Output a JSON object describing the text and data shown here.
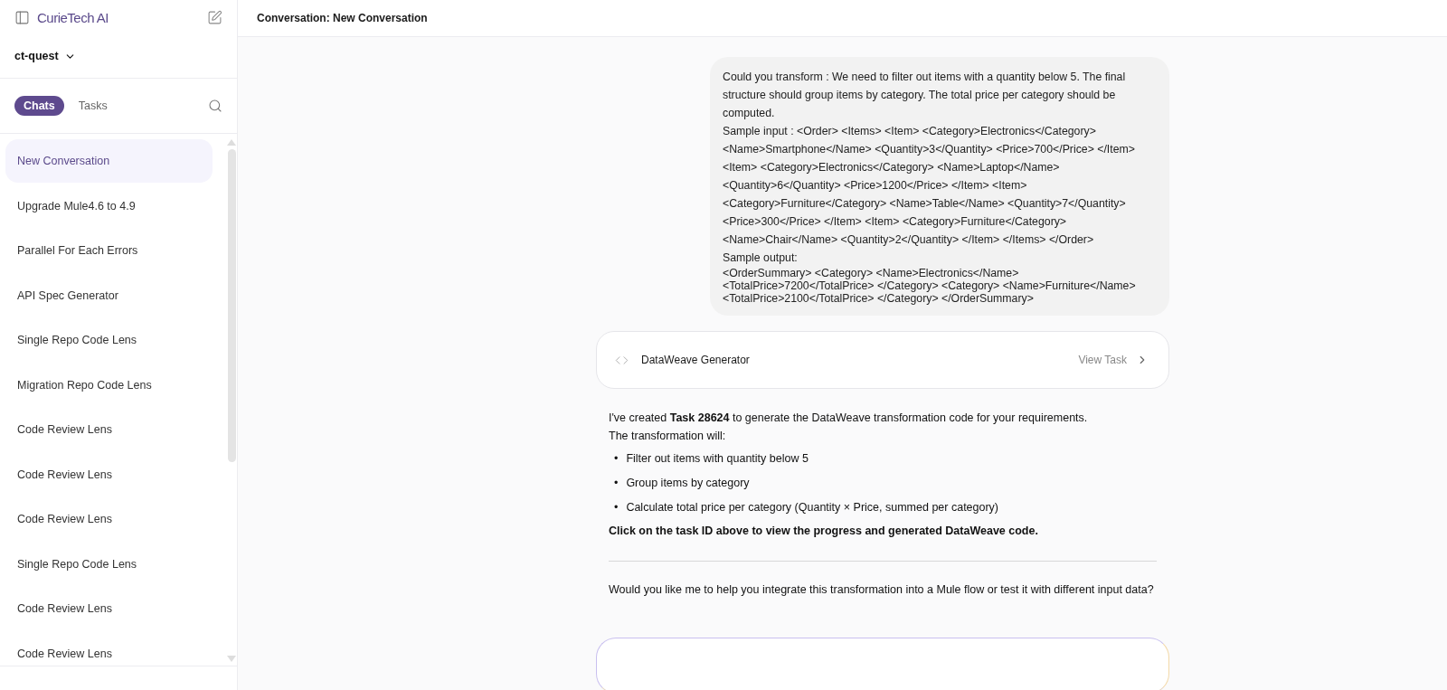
{
  "sidebar": {
    "brand": "CurieTech AI",
    "workspace": "ct-quest",
    "tabs": [
      {
        "label": "Chats",
        "selected": true
      },
      {
        "label": "Tasks",
        "selected": false
      }
    ],
    "items": [
      {
        "label": "New Conversation",
        "selected": true
      },
      {
        "label": "Upgrade Mule4.6 to 4.9",
        "selected": false
      },
      {
        "label": "Parallel For Each Errors",
        "selected": false
      },
      {
        "label": "API Spec Generator",
        "selected": false
      },
      {
        "label": "Single Repo Code Lens",
        "selected": false
      },
      {
        "label": "Migration Repo Code Lens",
        "selected": false
      },
      {
        "label": "Code Review Lens",
        "selected": false
      },
      {
        "label": "Code Review Lens",
        "selected": false
      },
      {
        "label": "Code Review Lens",
        "selected": false
      },
      {
        "label": "Single Repo Code Lens",
        "selected": false
      },
      {
        "label": "Code Review Lens",
        "selected": false
      },
      {
        "label": "Code Review Lens",
        "selected": false
      }
    ]
  },
  "header": {
    "title": "Conversation: New Conversation"
  },
  "user_message": {
    "paragraphs": [
      "Could you transform : We need to filter out items with a quantity below 5. The final structure should group items by category. The total price per category should be computed.",
      "Sample input : <Order> <Items> <Item> <Category>Electronics</Category> <Name>Smartphone</Name> <Quantity>3</Quantity> <Price>700</Price> </Item> <Item> <Category>Electronics</Category> <Name>Laptop</Name> <Quantity>6</Quantity> <Price>1200</Price> </Item> <Item> <Category>Furniture</Category> <Name>Table</Name> <Quantity>7</Quantity> <Price>300</Price> </Item> <Item> <Category>Furniture</Category> <Name>Chair</Name> <Quantity>2</Quantity> </Item> </Items> </Order>",
      "Sample output:"
    ],
    "output_lines": [
      "<OrderSummary> <Category> <Name>Electronics</Name>",
      "<TotalPrice>7200</TotalPrice> </Category> <Category> <Name>Furniture</Name>",
      "<TotalPrice>2100</TotalPrice> </Category> </OrderSummary>"
    ]
  },
  "task_card": {
    "title": "DataWeave Generator",
    "action": "View Task"
  },
  "assistant_message": {
    "intro": "I've created **Task 28624** to generate the DataWeave transformation code for your requirements.",
    "lead": "The transformation will:",
    "bullet_marker": "•",
    "bullets": [
      "Filter out items with quantity below 5",
      "Group items by category",
      "Calculate total price per category (Quantity × Price, summed per category)"
    ],
    "note": "Click on the task ID above to view the progress and generated DataWeave code.",
    "question": "Would you like me to help you integrate this transformation into a Mule flow or test it with different input data?"
  }
}
